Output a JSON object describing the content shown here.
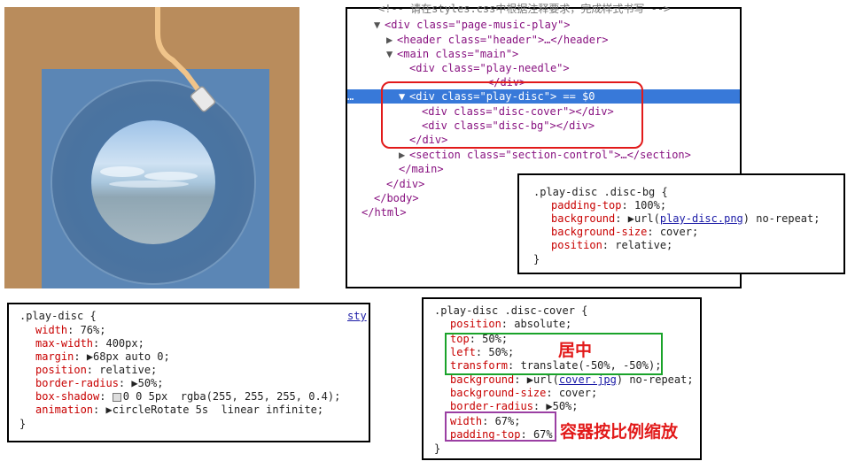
{
  "dom_tree": {
    "line0": "<!-- 请在styles.css中根据注释要求，完成样式书写 -->",
    "line1": "<div class=\"page-music-play\">",
    "line2": "<header class=\"header\">…</header>",
    "line3": "<main class=\"main\">",
    "line4": "<div class=\"play-needle\">",
    "line5": "</div>",
    "line6": "<div class=\"play-disc\"> == $0",
    "line7": "<div class=\"disc-cover\"></div>",
    "line8": "<div class=\"disc-bg\"></div>",
    "line9": "</div>",
    "line10": "<section class=\"section-control\">…</section>",
    "line11": "</main>",
    "line12": "</div>",
    "line13": "</body>",
    "line14": "</html>",
    "ellipsis": "…"
  },
  "disc_bg_rule": {
    "selector": ".play-disc .disc-bg {",
    "props": [
      {
        "name": "padding-top",
        "value": "100%;"
      },
      {
        "name": "background",
        "value_pre": "url(",
        "link": "play-disc.png",
        "value_post": ") no-repeat;"
      },
      {
        "name": "background-size",
        "value": "cover;"
      },
      {
        "name": "position",
        "value": "relative;"
      }
    ],
    "close": "}"
  },
  "play_disc_rule": {
    "selector": ".play-disc {",
    "source": "sty",
    "props": [
      {
        "name": "width",
        "value": "76%;"
      },
      {
        "name": "max-width",
        "value": "400px;"
      },
      {
        "name": "margin",
        "value": "68px auto 0;"
      },
      {
        "name": "position",
        "value": "relative;"
      },
      {
        "name": "border-radius",
        "value": "50%;"
      },
      {
        "name": "box-shadow",
        "value": "0 0 5px  rgba(255, 255, 255, 0.4);"
      },
      {
        "name": "animation",
        "value": "circleRotate 5s  linear infinite;"
      }
    ],
    "close": "}"
  },
  "disc_cover_rule": {
    "selector": ".play-disc .disc-cover {",
    "props": [
      {
        "name": "position",
        "value": "absolute;"
      },
      {
        "name": "top",
        "value": "50%;"
      },
      {
        "name": "left",
        "value": "50%;"
      },
      {
        "name": "transform",
        "value": "translate(-50%, -50%);"
      },
      {
        "name": "background",
        "value_pre": "url(",
        "link": "cover.jpg",
        "value_post": ") no-repeat;"
      },
      {
        "name": "background-size",
        "value": "cover;"
      },
      {
        "name": "border-radius",
        "value": "50%;"
      },
      {
        "name": "width",
        "value": "67%;"
      },
      {
        "name": "padding-top",
        "value": "67%;"
      }
    ],
    "close": "}"
  },
  "annotations": {
    "center": "居中",
    "scale": "容器按比例缩放"
  },
  "colors": {
    "highlight": "#3879d9",
    "red": "#e21a1a",
    "green": "#1aa32a",
    "purple": "#9b3fa3"
  }
}
